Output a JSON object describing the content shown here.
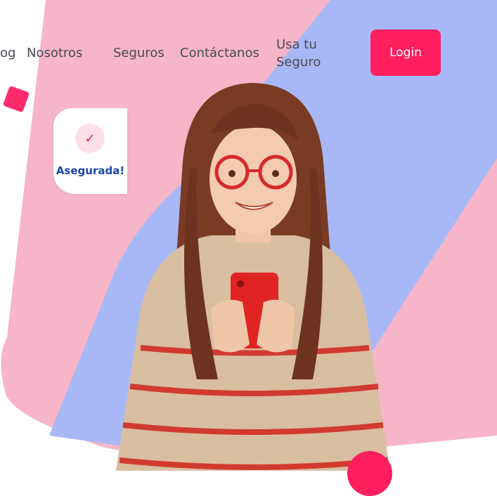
{
  "nav": {
    "items": [
      "og",
      "Nosotros",
      "Seguros",
      "Contáctanos",
      "Usa tu",
      "Seguro"
    ],
    "login_label": "Login"
  },
  "badge": {
    "label": "Asegurada!"
  },
  "colors": {
    "pink_bg": "#f6b5c8",
    "lavender_band": "#a8b8f7",
    "accent": "#ff1f5e",
    "badge_text": "#1b47a8"
  },
  "icons": [
    "check-icon"
  ]
}
